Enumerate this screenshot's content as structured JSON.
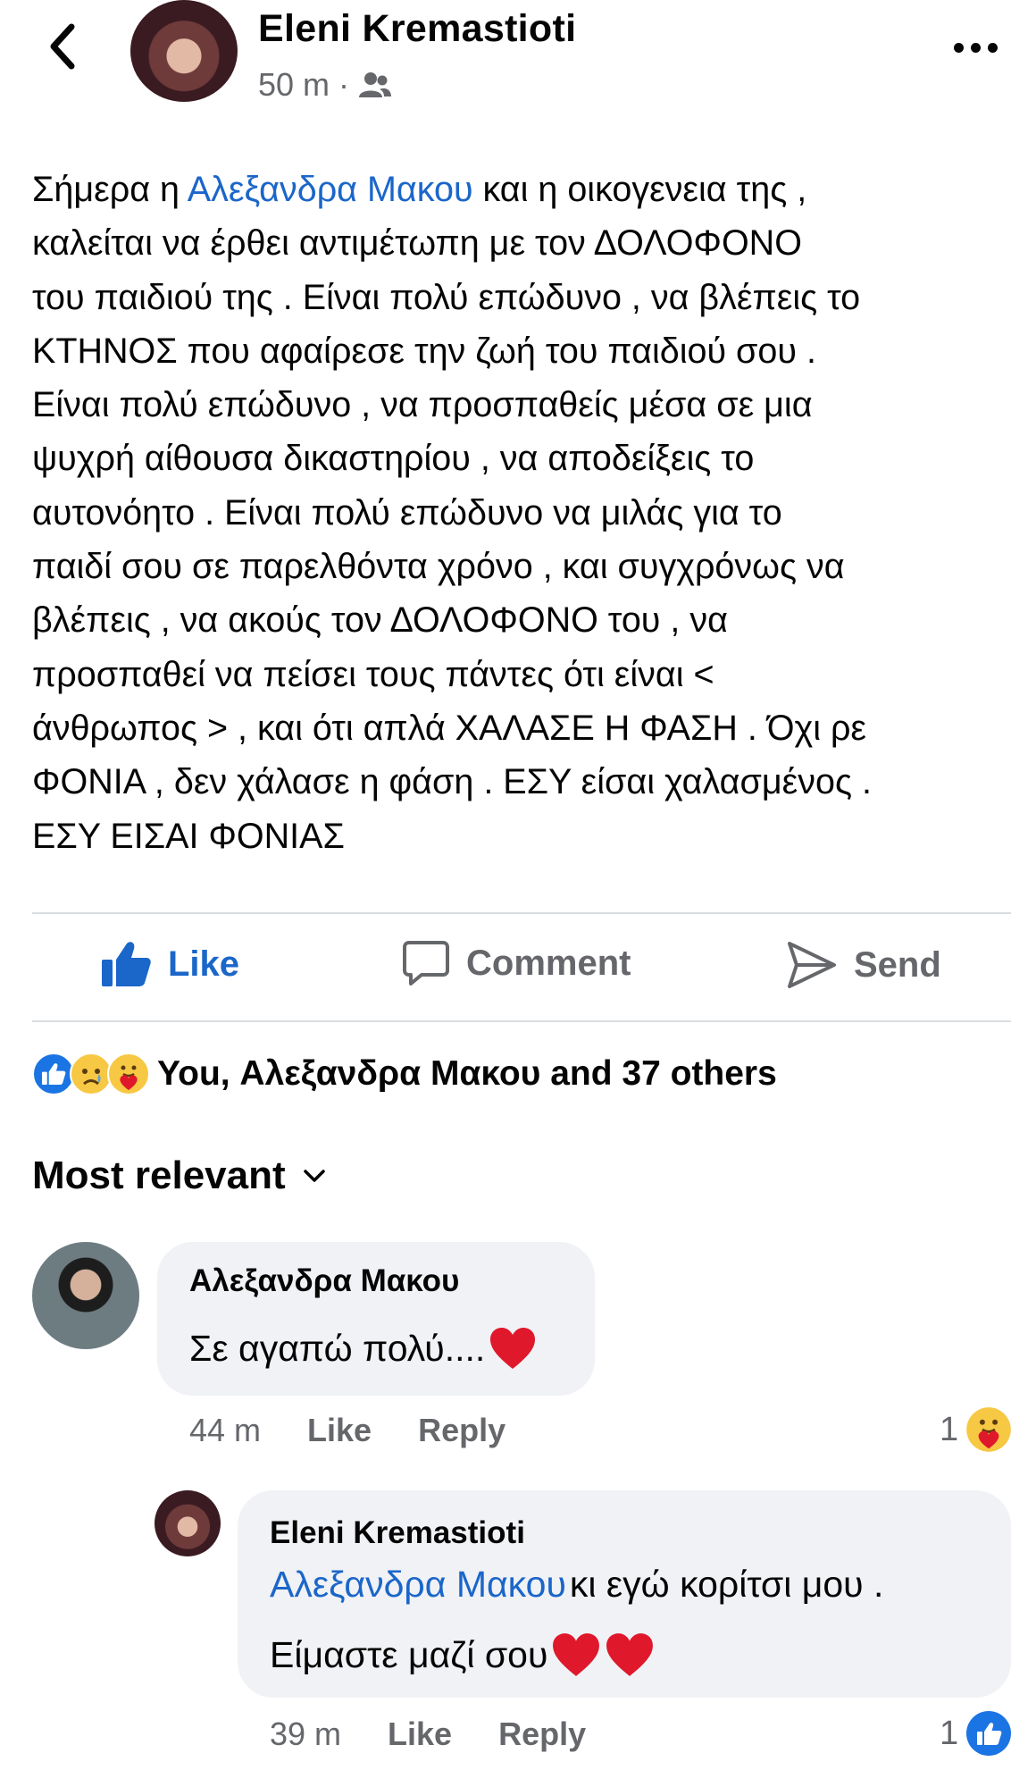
{
  "post": {
    "author": "Eleni Kremastioti",
    "time": "50 m",
    "separator": "·",
    "text_lines": [
      {
        "pre": "Σήμερα η ",
        "mention": "Αλεξανδρα Μακου",
        "post": " και η οικογενεια της ,"
      },
      {
        "pre": "καλείται να έρθει αντιμέτωπη με τον ΔΟΛΟΦΟΝΟ",
        "mention": "",
        "post": ""
      },
      {
        "pre": "του παιδιού της . Είναι πολύ επώδυνο , να βλέπεις το",
        "mention": "",
        "post": ""
      },
      {
        "pre": "ΚΤΗΝΟΣ που αφαίρεσε την ζωή του παιδιού σου .",
        "mention": "",
        "post": ""
      },
      {
        "pre": "Είναι πολύ επώδυνο , να προσπαθείς μέσα σε μια",
        "mention": "",
        "post": ""
      },
      {
        "pre": "ψυχρή αίθουσα δικαστηρίου , να αποδείξεις το",
        "mention": "",
        "post": ""
      },
      {
        "pre": "αυτονόητο . Είναι πολύ επώδυνο να μιλάς για το",
        "mention": "",
        "post": ""
      },
      {
        "pre": "παιδί σου σε παρελθόντα χρόνο , και συγχρόνως να",
        "mention": "",
        "post": ""
      },
      {
        "pre": "βλέπεις , να ακούς τον ΔΟΛΟΦΟΝΟ του , να",
        "mention": "",
        "post": ""
      },
      {
        "pre": "προσπαθεί να πείσει τους πάντες ότι είναι <",
        "mention": "",
        "post": ""
      },
      {
        "pre": "άνθρωπος > , και ότι απλά ΧΑΛΑΣΕ Η ΦΑΣΗ . Όχι ρε",
        "mention": "",
        "post": ""
      },
      {
        "pre": "ΦΟΝΙΑ , δεν χάλασε η φάση . ΕΣΥ είσαι χαλασμένος .",
        "mention": "",
        "post": ""
      },
      {
        "pre": "ΕΣΥ ΕΙΣΑΙ ΦΟΝΙΑΣ",
        "mention": "",
        "post": ""
      }
    ]
  },
  "actions": {
    "like": "Like",
    "comment": "Comment",
    "send": "Send"
  },
  "reactions": {
    "summary": "You, Αλεξανδρα Μακου and 37 others",
    "icons": [
      "like-icon",
      "sad-icon",
      "care-icon"
    ]
  },
  "sort": {
    "label": "Most relevant"
  },
  "comments": [
    {
      "author": "Αλεξανδρα Μακου",
      "text": "Σε αγαπώ πολύ....",
      "emoji": [
        "heart-icon"
      ],
      "time": "44 m",
      "like": "Like",
      "reply": "Reply",
      "reaction_count": "1",
      "reaction_icon": "care-icon"
    },
    {
      "author": "Eleni Kremastioti",
      "mention": "Αλεξανδρα Μακου",
      "text_after_mention": " κι εγώ κορίτσι μου .",
      "text_line2": "Είμαστε μαζί σου",
      "emoji": [
        "heart-icon",
        "heart-icon"
      ],
      "time": "39 m",
      "like": "Like",
      "reply": "Reply",
      "reaction_count": "1",
      "reaction_icon": "like-icon"
    }
  ],
  "colors": {
    "accent": "#1b66c9",
    "secondary_text": "#65676b",
    "bubble": "#f0f2f5",
    "heart": "#e0182b"
  }
}
